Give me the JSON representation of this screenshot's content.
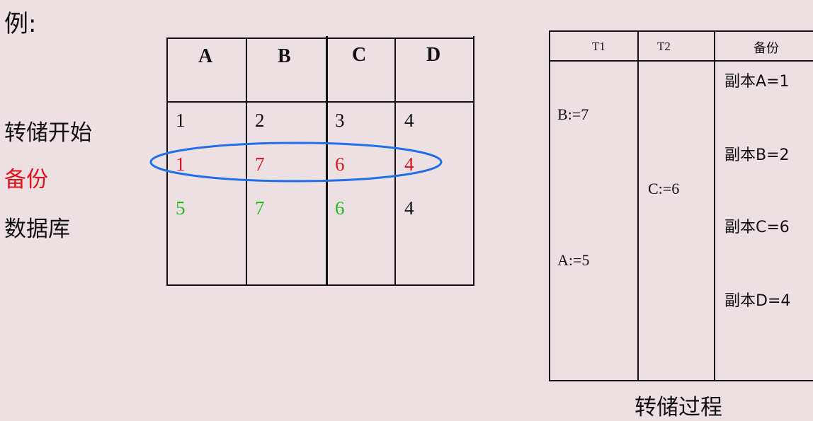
{
  "example_label": "例:",
  "row_labels": [
    {
      "text": "转储开始",
      "color": "#111111"
    },
    {
      "text": "备份",
      "color": "#e0141e"
    },
    {
      "text": "数据库",
      "color": "#111111"
    }
  ],
  "left_table": {
    "headers": [
      "A",
      "B",
      "C",
      "D"
    ],
    "rows": [
      {
        "values": [
          "1",
          "2",
          "3",
          "4"
        ],
        "colors": [
          "#111111",
          "#111111",
          "#111111",
          "#111111"
        ]
      },
      {
        "values": [
          "1",
          "7",
          "6",
          "4"
        ],
        "colors": [
          "#e0141e",
          "#e0141e",
          "#e0141e",
          "#e0141e"
        ]
      },
      {
        "values": [
          "5",
          "7",
          "6",
          "4"
        ],
        "colors": [
          "#22bb22",
          "#22bb22",
          "#22bb22",
          "#111111"
        ]
      }
    ],
    "highlight_color": "#1f6fe8"
  },
  "right_table": {
    "headers": [
      "T1",
      "T2",
      "备份"
    ],
    "t1": [
      "B:=7",
      "A:=5"
    ],
    "t2": [
      "C:=6"
    ],
    "backup": [
      "副本A=1",
      "副本B=2",
      "副本C=6",
      "副本D=4"
    ],
    "caption": "转储过程"
  }
}
